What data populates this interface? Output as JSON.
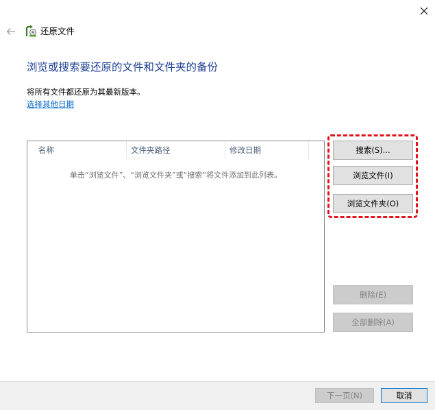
{
  "window": {
    "title": "还原文件",
    "close_icon": "close-icon",
    "back_icon": "back-arrow-icon",
    "app_icon": "restore-files-icon"
  },
  "main": {
    "heading": "浏览或搜索要还原的文件和文件夹的备份",
    "info": "将所有文件都还原为其最新版本。",
    "choose_date_link": "选择其他日期"
  },
  "file_list": {
    "columns": [
      "名称",
      "文件夹路径",
      "修改日期"
    ],
    "empty_message": "单击“浏览文件”、“浏览文件夹”或“搜索”将文件添加到此列表。"
  },
  "buttons": {
    "search": "搜索(S)...",
    "browse_files": "浏览文件(I)",
    "browse_folders": "浏览文件夹(O)",
    "delete": "删除(E)",
    "delete_all": "全部删除(A)"
  },
  "footer": {
    "next": "下一页(N)",
    "cancel": "取消"
  },
  "colors": {
    "heading": "#1c3f94",
    "link": "#0066cc",
    "highlight": "#e0151b",
    "default_button_border": "#0078d7"
  }
}
